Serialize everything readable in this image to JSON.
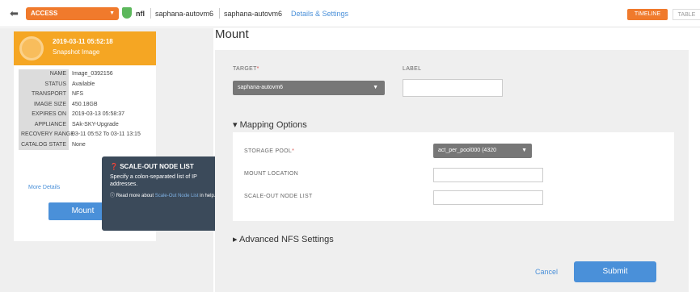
{
  "topbar": {
    "access_label": "ACCESS",
    "host": "nfl",
    "crumb1": "saphana-autovm6",
    "crumb2": "saphana-autovm6",
    "details_link": "Details & Settings",
    "tab_timeline": "TIMELINE",
    "tab_table": "TABLE"
  },
  "snapshot": {
    "date": "2019-03-11 05:52:18",
    "subtitle": "Snapshot Image",
    "properties": [
      {
        "key": "NAME",
        "value": "Image_0392156"
      },
      {
        "key": "STATUS",
        "value": "Available"
      },
      {
        "key": "TRANSPORT",
        "value": "NFS"
      },
      {
        "key": "IMAGE SIZE",
        "value": "450.18GB"
      },
      {
        "key": "EXPIRES ON",
        "value": "2019-03-13 05:58:37"
      },
      {
        "key": "APPLIANCE",
        "value": "SAk-SKY-Upgrade"
      },
      {
        "key": "RECOVERY RANGE",
        "value": "03-11 05:52 To 03-11 13:15"
      },
      {
        "key": "CATALOG STATE",
        "value": "None"
      }
    ],
    "more_details": "More Details",
    "mount_button": "Mount"
  },
  "tooltip": {
    "title": "SCALE-OUT NODE LIST",
    "body": "Specify a colon-separated list of IP addresses.",
    "foot_prefix": "Read more about",
    "foot_link": "Scale-Out Node List",
    "foot_suffix": "in help."
  },
  "page": {
    "title": "Mount"
  },
  "form": {
    "target_label": "TARGET",
    "target_value": "saphana-autovm6",
    "label_label": "LABEL",
    "label_value": "",
    "mapping_toggle": "Mapping Options",
    "storage_pool_label": "STORAGE POOL",
    "storage_pool_value": "act_per_pool000 (4320",
    "mount_location_label": "MOUNT LOCATION",
    "mount_location_value": "",
    "scaleout_label": "SCALE-OUT NODE LIST",
    "scaleout_value": "",
    "advanced_toggle": "Advanced NFS Settings",
    "cancel": "Cancel",
    "submit": "Submit"
  },
  "colors": {
    "accent": "#f07a2c",
    "snapshot": "#f5a623",
    "primary": "#4a90d9",
    "tooltip_bg": "#3b4a5a"
  }
}
